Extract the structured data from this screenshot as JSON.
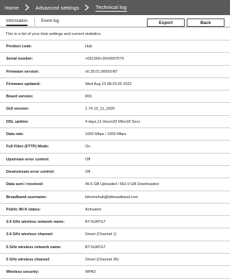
{
  "breadcrumb": {
    "items": [
      "Home",
      "Advanced settings",
      "Technical log"
    ]
  },
  "tabs": [
    "Information",
    "Event log"
  ],
  "buttons": {
    "export": "Export",
    "back": "Back"
  },
  "intro": "This is a list of your Hub settings and current statistics.",
  "rows": [
    {
      "label": "Product code:",
      "value": "Hub"
    },
    {
      "label": "Serial number:",
      "value": "+091300+2043007679"
    },
    {
      "label": "Firmware version:",
      "value": "v0.35.01.06093-BT"
    },
    {
      "label": "Firmware updated:",
      "value": "Wed Aug 10 08:23:35 2022"
    },
    {
      "label": "Board version:",
      "value": "R01"
    },
    {
      "label": "GUI version:",
      "value": "1.74 12_11_2020"
    },
    {
      "label": "DSL uptime:",
      "value": "4 days,11 Hours32 Mins18 Secs"
    },
    {
      "label": "Data rate:",
      "value": "1000 Mbps / 1000 Mbps"
    },
    {
      "label": "Full Fibre (FTTP) Mode:",
      "value": "On"
    },
    {
      "label": "Upstream error control:",
      "value": "Off"
    },
    {
      "label": "Downstream error control:",
      "value": "Off"
    },
    {
      "label": "Data sent / received:",
      "value": "49.6 GB Uploaded / 662.0 GB Downloaded"
    },
    {
      "label": "Broadband username:",
      "value": "bthomehub@btbroadband.com"
    },
    {
      "label": "Public Wi-fi status:",
      "value": "Activated"
    },
    {
      "label": "2.4 GHz wireless network name:",
      "value": "BT-NJATG7"
    },
    {
      "label": "2.4 GHz wireless channel:",
      "value": "Smart (Channel 1)"
    },
    {
      "label": "5 GHz wireless network name:",
      "value": "BT-NJATG7"
    },
    {
      "label": "5 GHz wireless channel:",
      "value": "Smart (Channel 36)"
    },
    {
      "label": "Wireless security:",
      "value": "WPA2"
    }
  ]
}
